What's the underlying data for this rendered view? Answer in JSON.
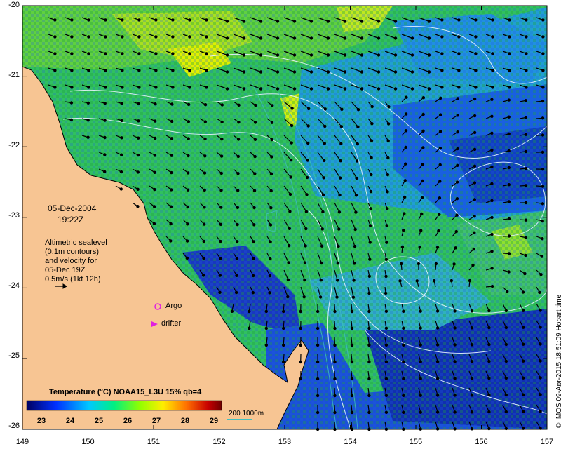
{
  "map": {
    "date": "05-Dec-2004",
    "time": "19:22Z",
    "legend_lines": [
      "Altimetric sealevel",
      "(0.1m contours)",
      "and velocity for",
      "05-Dec 19Z",
      "0.5m/s (1kt 12h)"
    ],
    "argo_label": "Argo",
    "drifter_label": "drifter",
    "colorbar_title": "Temperature (°C) NOAA15_L3U 15% qb=4",
    "colorbar_ticks": [
      "23",
      "24",
      "25",
      "26",
      "27",
      "28",
      "29"
    ],
    "depth_label": "200  1000m",
    "credit": "© IMOS 09-Apr-2015 18:51:09 Hobart time",
    "lat_ticks": [
      "-20",
      "-21",
      "-22",
      "-23",
      "-24",
      "-25",
      "-26"
    ],
    "lon_ticks": [
      "149",
      "150",
      "151",
      "152",
      "153",
      "154",
      "155",
      "156",
      "157"
    ],
    "colors": {
      "land": "#f7c593",
      "sst_scale": [
        "#000080",
        "#0040ff",
        "#00c0ff",
        "#00ff80",
        "#80ff00",
        "#ffff00",
        "#ff8000",
        "#c00000",
        "#800000"
      ],
      "argo": "#e020e0",
      "depth_contour": "#40c0c0"
    }
  }
}
